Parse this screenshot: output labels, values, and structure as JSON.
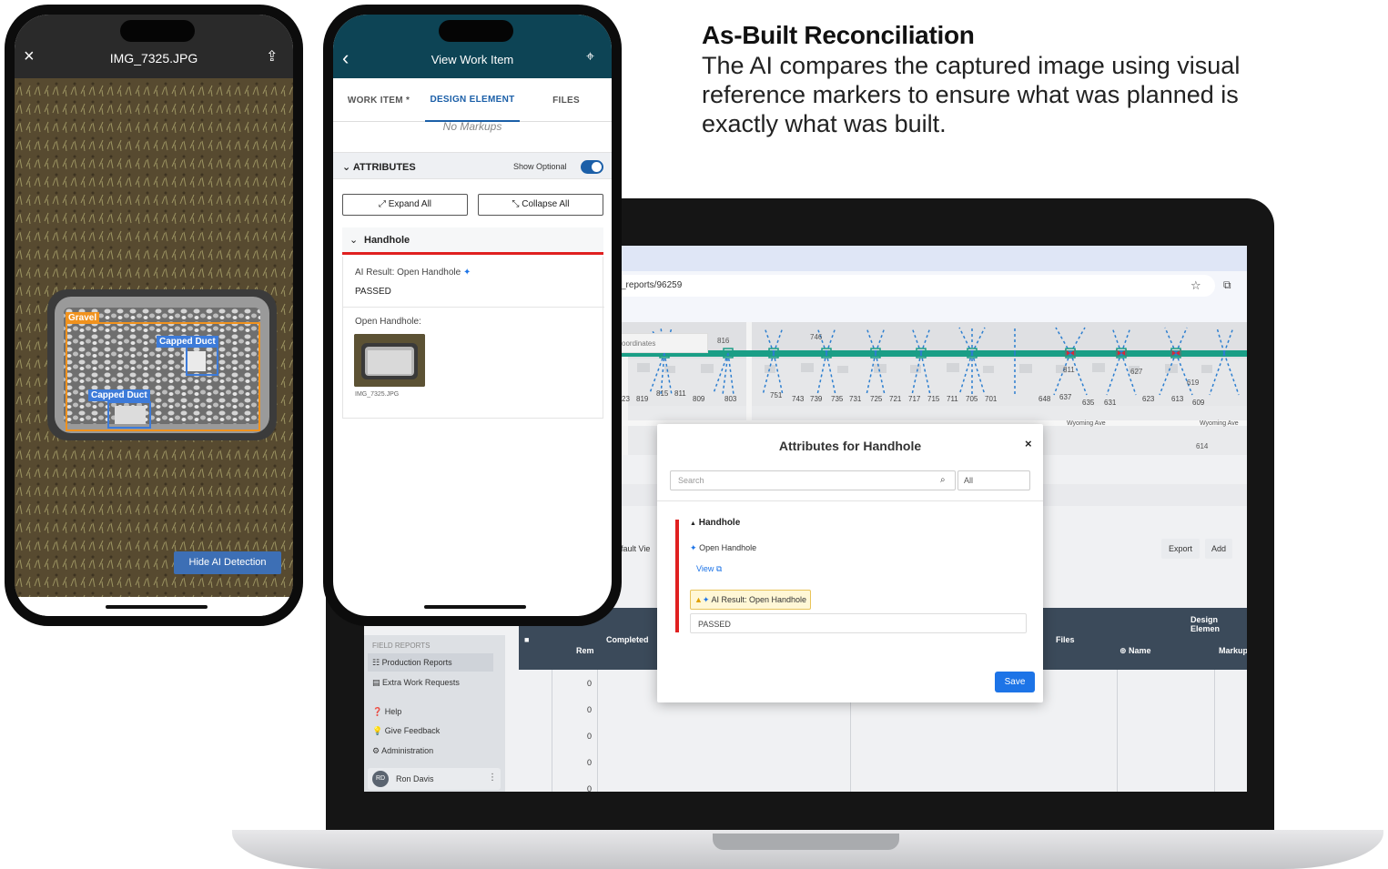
{
  "headline": {
    "title": "As-Built Reconciliation",
    "body": "The AI compares the captured image using visual reference markers to ensure what was planned is exactly what was built."
  },
  "phone1": {
    "close_icon": "×",
    "title": "IMG_7325.JPG",
    "share_icon": "⇪",
    "detections": [
      {
        "label": "Gravel",
        "color": "#f0921e"
      },
      {
        "label": "Capped Duct",
        "color": "#3d7bd9"
      },
      {
        "label": "Capped Duct",
        "color": "#3d7bd9"
      }
    ],
    "hide_button": "Hide AI Detection"
  },
  "phone2": {
    "title": "View Work Item",
    "tabs": {
      "work_item": "WORK ITEM *",
      "design_element": "DESIGN ELEMENT",
      "files": "FILES"
    },
    "no_markups": "No Markups",
    "attributes_label": "ATTRIBUTES",
    "show_optional": "Show Optional",
    "expand_all": "Expand All",
    "collapse_all": "Collapse All",
    "group": "Handhole",
    "ai_result": "AI Result: Open Handhole",
    "passed": "PASSED",
    "open_handhole_label": "Open Handhole:",
    "thumb_name": "IMG_7325.JPG"
  },
  "laptop": {
    "url": "_reports/96259",
    "coords_label": "oordinates",
    "map_numbers": [
      "816",
      "746",
      "811",
      "627",
      "619",
      "23",
      "819",
      "815",
      "811",
      "809",
      "803",
      "751",
      "743",
      "739",
      "735",
      "731",
      "725",
      "721",
      "717",
      "715",
      "711",
      "705",
      "701",
      "648",
      "637",
      "635",
      "631",
      "623",
      "613",
      "609",
      "614"
    ],
    "street": "Wyoming Ave",
    "view_label": "fault Vie",
    "export": "Export",
    "add": "Add",
    "sidebar": {
      "heading": "FIELD REPORTS",
      "items": [
        "Production Reports",
        "Extra Work Requests",
        "Help",
        "Give Feedback",
        "Administration"
      ],
      "user_initials": "RD",
      "user_name": "Ron Davis"
    },
    "table": {
      "rem": "Rem",
      "completed": "Completed",
      "files": "Files",
      "design_element": "Design Elemen",
      "name": "Name",
      "markup": "Markup",
      "rem_values": [
        "0",
        "0",
        "0",
        "0",
        "0"
      ]
    },
    "modal": {
      "title": "Attributes for Handhole",
      "close": "×",
      "search_placeholder": "Search",
      "filter": "All",
      "group": "Handhole",
      "attribute": "Open Handhole",
      "view_link": "View",
      "ai_result": "AI Result: Open Handhole",
      "value": "PASSED",
      "save": "Save"
    }
  }
}
